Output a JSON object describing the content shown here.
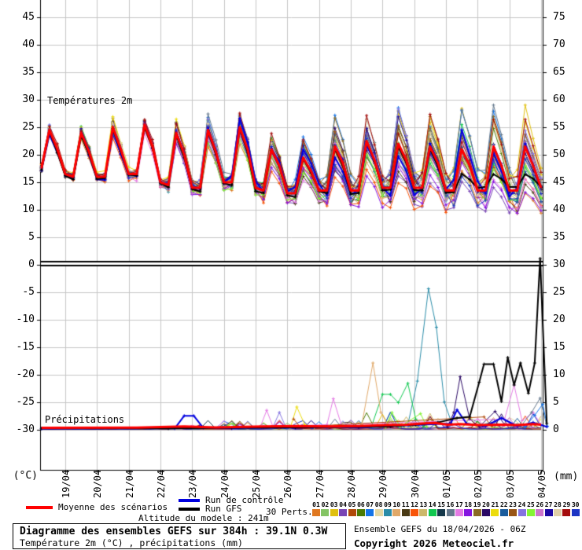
{
  "chart": {
    "temp_label": "Températures 2m",
    "precip_label": "Précipitations",
    "left_axis_unit": "(°C)",
    "right_axis_unit": "(mm)",
    "left_ticks": [
      45,
      40,
      35,
      30,
      25,
      20,
      15,
      10,
      5,
      0,
      -5,
      -10,
      -15,
      -20,
      -25,
      -30
    ],
    "right_ticks": [
      75,
      70,
      65,
      60,
      55,
      50,
      45,
      40,
      35,
      30,
      25,
      20,
      15,
      10,
      5,
      0
    ]
  },
  "legend": {
    "mean_label": "Moyenne des scénarios",
    "control_label": "Run de contrôle",
    "gfs_label": "Run GFS",
    "perts_label": "30 Perts.",
    "mean_color": "#ff0000",
    "control_color": "#0000e0",
    "gfs_color": "#000000",
    "grid_color": "#c6c6c6",
    "pert_numbers": [
      "01",
      "02",
      "03",
      "04",
      "05",
      "06",
      "07",
      "08",
      "09",
      "10",
      "11",
      "12",
      "13",
      "14",
      "15",
      "16",
      "17",
      "18",
      "19",
      "20",
      "21",
      "22",
      "23",
      "24",
      "25",
      "26",
      "27",
      "28",
      "29",
      "30"
    ],
    "pert_colors": [
      "#e07820",
      "#84c464",
      "#e0c010",
      "#7844b4",
      "#b04808",
      "#4a7a04",
      "#1474e8",
      "#e4d8a4",
      "#2a8ca8",
      "#e0a868",
      "#4a3a14",
      "#f85408",
      "#ccb86a",
      "#10c850",
      "#14384a",
      "#64788c",
      "#e47ae4",
      "#8414e0",
      "#8a6a24",
      "#2a0864",
      "#ecdc0c",
      "#1a5c9c",
      "#985414",
      "#8474e0",
      "#84f434",
      "#cc74cc",
      "#1c08a4",
      "#e0d0a8",
      "#a40c0c",
      "#1c34c4"
    ]
  },
  "footer": {
    "altitude": "Altitude du modele : 241m",
    "title_bold": "Diagramme des ensembles GEFS sur 384h : 39.1N 0.3W",
    "title_sub": "Température 2m (°C) , précipitations (mm)",
    "run_info": "Ensemble GEFS du 18/04/2026 - 06Z",
    "copyright": "Copyright 2026 Meteociel.fr"
  },
  "chart_data": {
    "type": "line",
    "title": "Diagramme des ensembles GEFS sur 384h : 39.1N 0.3W",
    "subtitle": "Température 2m (°C) , précipitations (mm)",
    "run": "Ensemble GEFS du 18/04/2026 - 06Z",
    "x_start": "18/04 06Z",
    "x_step_hours": 6,
    "x_labels": [
      "19/04",
      "20/04",
      "21/04",
      "22/04",
      "23/04",
      "24/04",
      "25/04",
      "26/04",
      "27/04",
      "28/04",
      "29/04",
      "30/04",
      "01/05",
      "02/05",
      "03/05",
      "04/05"
    ],
    "temp_axis": {
      "label": "°C",
      "range_visible": [
        -30,
        47
      ],
      "ticks_step": 5
    },
    "precip_axis": {
      "label": "mm",
      "range": [
        0,
        75
      ],
      "ticks_step": 5
    },
    "temperature": {
      "mean_6h": [
        17.5,
        24.5,
        21.0,
        16.5,
        16.0,
        24.0,
        20.5,
        16.0,
        16.0,
        25.0,
        21.0,
        16.5,
        16.5,
        25.5,
        21.5,
        15.0,
        14.5,
        24.0,
        20.0,
        14.0,
        14.0,
        24.5,
        20.5,
        15.0,
        15.0,
        25.0,
        21.0,
        14.0,
        13.5,
        21.0,
        18.0,
        13.0,
        13.0,
        19.5,
        17.0,
        13.5,
        13.5,
        21.5,
        18.5,
        13.5,
        13.5,
        22.5,
        19.0,
        14.0,
        14.0,
        22.0,
        19.0,
        14.0,
        14.0,
        21.5,
        18.5,
        13.5,
        13.5,
        21.0,
        18.0,
        13.5,
        13.5,
        21.5,
        18.0,
        13.5,
        13.5,
        21.5,
        18.0,
        14.0
      ],
      "spread_amp_per_day": [
        0.8,
        1.0,
        1.2,
        1.5,
        1.8,
        2.2,
        2.6,
        3.0,
        3.5,
        4.0,
        4.5,
        5.0,
        5.5,
        5.8,
        6.0,
        6.2
      ],
      "gfs_flat_value_late": 14.3
    },
    "precipitation": {
      "mean": [
        [
          0,
          0.2
        ],
        [
          3,
          0.25
        ],
        [
          4.5,
          0.45
        ],
        [
          5.5,
          0.3
        ],
        [
          7,
          0.45
        ],
        [
          8,
          0.55
        ],
        [
          9,
          0.45
        ],
        [
          10,
          0.55
        ],
        [
          10.8,
          0.7
        ],
        [
          11.5,
          0.8
        ],
        [
          12,
          1.0
        ],
        [
          12.4,
          1.1
        ],
        [
          12.8,
          0.8
        ],
        [
          13.2,
          0.9
        ],
        [
          13.8,
          0.7
        ],
        [
          14.5,
          0.8
        ],
        [
          15,
          0.7
        ],
        [
          15.5,
          0.9
        ],
        [
          15.75,
          0.8
        ]
      ],
      "control": [
        [
          0,
          0.05
        ],
        [
          4.2,
          0.1
        ],
        [
          4.5,
          2.4
        ],
        [
          4.8,
          2.4
        ],
        [
          5.1,
          0.2
        ],
        [
          6,
          0.1
        ],
        [
          7,
          0.3
        ],
        [
          8,
          0.2
        ],
        [
          9,
          0.4
        ],
        [
          10,
          0.3
        ],
        [
          11,
          0.5
        ],
        [
          12,
          0.8
        ],
        [
          12.9,
          1.0
        ],
        [
          13.1,
          3.5
        ],
        [
          13.4,
          1.0
        ],
        [
          14,
          0.5
        ],
        [
          14.5,
          2.0
        ],
        [
          15,
          0.5
        ],
        [
          15.5,
          1.2
        ],
        [
          15.93,
          0.4
        ]
      ],
      "gfs": [
        [
          0,
          0.1
        ],
        [
          4,
          0.1
        ],
        [
          6,
          0.2
        ],
        [
          8,
          0.3
        ],
        [
          10,
          0.4
        ],
        [
          11,
          0.5
        ],
        [
          11.8,
          0.8
        ],
        [
          12.5,
          1.2
        ],
        [
          13.1,
          2.0
        ],
        [
          13.5,
          2.2
        ],
        [
          13.8,
          8.5
        ],
        [
          13.95,
          11.8
        ],
        [
          14.25,
          11.8
        ],
        [
          14.5,
          5.0
        ],
        [
          14.7,
          13.0
        ],
        [
          14.9,
          8.0
        ],
        [
          15.1,
          12.0
        ],
        [
          15.35,
          6.5
        ],
        [
          15.55,
          12.0
        ],
        [
          15.72,
          31.0
        ],
        [
          15.93,
          1.0
        ]
      ],
      "member_events": [
        {
          "member": 9,
          "points": [
            [
              11.55,
              0.8
            ],
            [
              11.85,
              8.7
            ],
            [
              12.2,
              25.5
            ],
            [
              12.45,
              18.5
            ],
            [
              12.7,
              4.9
            ],
            [
              12.95,
              0.8
            ]
          ]
        },
        {
          "member": 14,
          "points": [
            [
              10.4,
              0.4
            ],
            [
              10.75,
              6.3
            ],
            [
              11.0,
              6.3
            ],
            [
              11.25,
              4.8
            ],
            [
              11.55,
              8.3
            ],
            [
              11.8,
              1.8
            ],
            [
              12.05,
              0.4
            ]
          ]
        },
        {
          "member": 20,
          "points": [
            [
              12.8,
              0.4
            ],
            [
              13.0,
              3.0
            ],
            [
              13.2,
              9.5
            ],
            [
              13.5,
              1.8
            ],
            [
              13.8,
              0.4
            ],
            [
              14.3,
              3.2
            ],
            [
              14.6,
              0.8
            ]
          ]
        },
        {
          "member": 17,
          "points": [
            [
              6.9,
              0.4
            ],
            [
              7.1,
              3.4
            ],
            [
              7.3,
              0.4
            ],
            [
              9.0,
              0.8
            ],
            [
              9.2,
              5.5
            ],
            [
              9.45,
              0.8
            ],
            [
              14.6,
              1.8
            ],
            [
              14.9,
              8.0
            ],
            [
              15.15,
              1.5
            ],
            [
              15.5,
              3.0
            ],
            [
              15.75,
              0.8
            ]
          ]
        },
        {
          "member": 16,
          "points": [
            [
              15.1,
              0.4
            ],
            [
              15.45,
              3.0
            ],
            [
              15.72,
              5.6
            ],
            [
              15.93,
              0.5
            ]
          ]
        },
        {
          "member": 7,
          "points": [
            [
              15.25,
              0.4
            ],
            [
              15.55,
              2.5
            ],
            [
              15.8,
              4.5
            ],
            [
              15.95,
              0.5
            ]
          ]
        },
        {
          "member": 25,
          "points": [
            [
              10.85,
              0.3
            ],
            [
              11.05,
              3.0
            ],
            [
              11.3,
              0.4
            ],
            [
              11.95,
              2.8
            ],
            [
              12.15,
              0.4
            ]
          ]
        },
        {
          "member": 21,
          "points": [
            [
              7.85,
              0.4
            ],
            [
              8.05,
              4.0
            ],
            [
              8.3,
              0.8
            ],
            [
              8.6,
              0.3
            ]
          ]
        },
        {
          "member": 24,
          "points": [
            [
              7.3,
              0.4
            ],
            [
              7.5,
              3.0
            ],
            [
              7.7,
              0.4
            ]
          ]
        },
        {
          "member": 5,
          "points": [
            [
              7.95,
              1.8
            ],
            [
              8.15,
              0.4
            ],
            [
              13.95,
              2.2
            ],
            [
              14.2,
              0.5
            ]
          ]
        },
        {
          "member": 10,
          "points": [
            [
              10.1,
              0.8
            ],
            [
              10.45,
              12.0
            ],
            [
              10.7,
              3.0
            ],
            [
              10.95,
              0.5
            ]
          ]
        }
      ]
    }
  }
}
